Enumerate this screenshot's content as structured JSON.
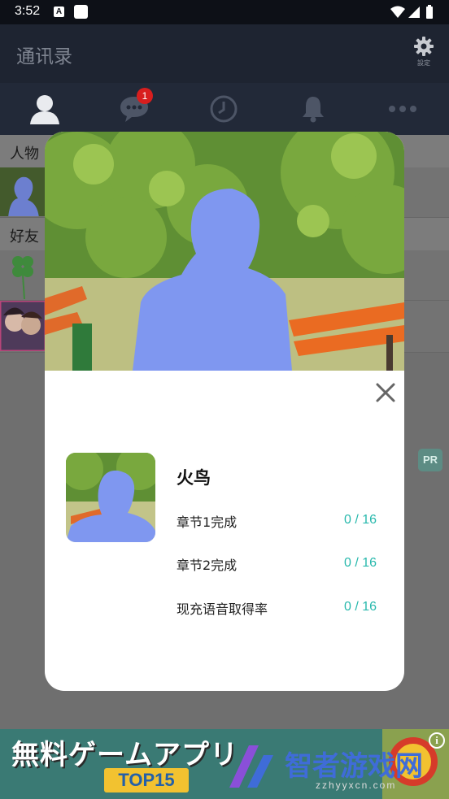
{
  "status_bar": {
    "time": "3:52",
    "a_icon": "A"
  },
  "header": {
    "title": "通讯录",
    "settings_label": "設定"
  },
  "tabs": [
    {
      "icon": "person-icon"
    },
    {
      "icon": "chat-icon",
      "badge": "1"
    },
    {
      "icon": "clock-icon"
    },
    {
      "icon": "bell-icon"
    },
    {
      "icon": "more-icon"
    }
  ],
  "background_list": {
    "section_1": "人物",
    "section_2": "好友",
    "pr_badge": "PR"
  },
  "modal": {
    "character_name": "火鸟",
    "stats": [
      {
        "label": "章节1完成",
        "value": "0 / 16"
      },
      {
        "label": "章节2完成",
        "value": "0 / 16"
      },
      {
        "label": "现充语音取得率",
        "value": "0 / 16"
      }
    ]
  },
  "ad": {
    "text": "無料ゲームアプリ",
    "badge": "TOP15",
    "info": "i"
  },
  "watermark": {
    "text": "智者游戏网",
    "url": "zzhyyxcn.com"
  },
  "colors": {
    "accent_teal": "#27b8ac",
    "badge_red": "#d81e1e",
    "header_bg": "#1e2431",
    "silhouette_blue": "#7f97f0"
  }
}
